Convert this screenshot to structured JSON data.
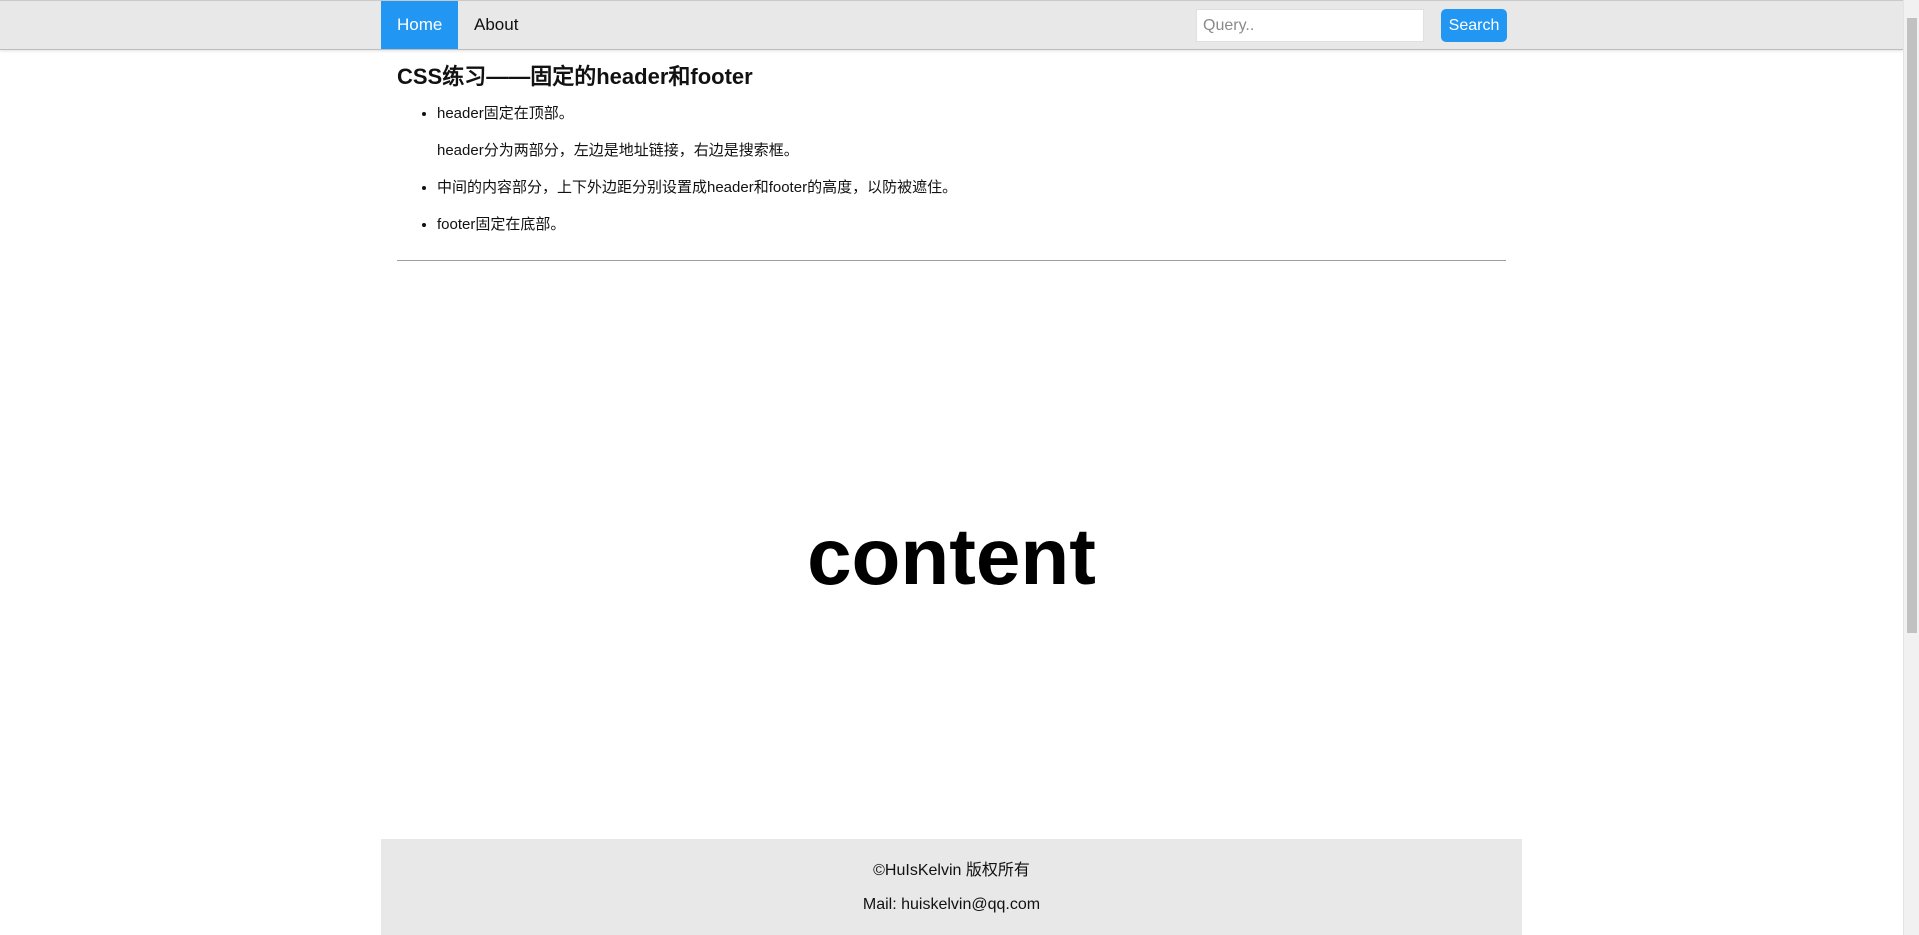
{
  "header": {
    "nav": [
      {
        "label": "Home",
        "active": true
      },
      {
        "label": "About",
        "active": false
      }
    ],
    "search": {
      "placeholder": "Query..",
      "value": "",
      "button_label": "Search"
    },
    "accent_color": "#2196f3",
    "background_color": "#e8e8e8"
  },
  "main": {
    "title": "CSS练习——固定的header和footer",
    "notes": [
      {
        "text": "header固定在顶部。",
        "subtext": "header分为两部分，左边是地址链接，右边是搜索框。"
      },
      {
        "text": "中间的内容部分，上下外边距分别设置成header和footer的高度，以防被遮住。"
      },
      {
        "text": "footer固定在底部。"
      }
    ],
    "content_text": "content"
  },
  "footer": {
    "copyright": "©HuIsKelvin 版权所有",
    "mail": "Mail: huiskelvin@qq.com"
  }
}
